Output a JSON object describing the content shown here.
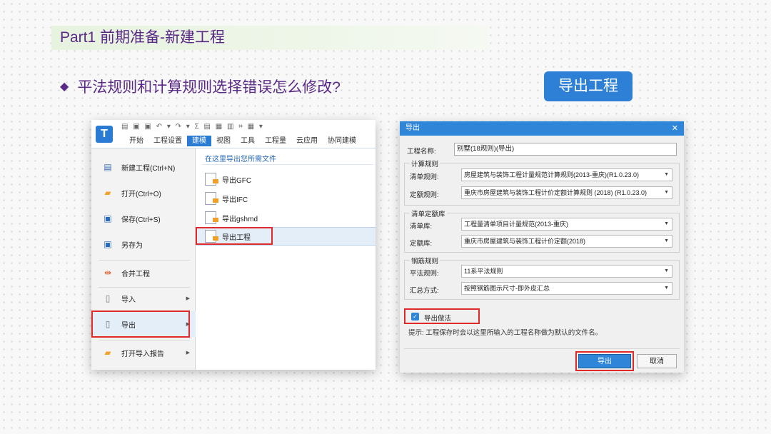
{
  "slide": {
    "title": "Part1 前期准备-新建工程",
    "bullet_symbol": "◆",
    "question": "平法规则和计算规则选择错误怎么修改?",
    "export_button": "导出工程"
  },
  "left_shot": {
    "logo": "T",
    "quick_access": "▤ ▣ ▣ ↶ ▾ ↷ ▾ Σ ▤ ▦ ▥ ⌗ ▦ ▾",
    "tabs": [
      "开始",
      "工程设置",
      "建模",
      "视图",
      "工具",
      "工程量",
      "云应用",
      "协同建模"
    ],
    "active_tab": "建模",
    "file_menu": [
      {
        "label": "新建工程(Ctrl+N)",
        "icon": "new-file-icon"
      },
      {
        "label": "打开(Ctrl+O)",
        "icon": "folder-open-icon"
      },
      {
        "label": "保存(Ctrl+S)",
        "icon": "save-icon"
      },
      {
        "label": "另存为",
        "icon": "save-as-icon"
      },
      {
        "label": "合并工程",
        "icon": "merge-icon"
      },
      {
        "label": "导入",
        "icon": "import-icon"
      },
      {
        "label": "导出",
        "icon": "export-icon"
      },
      {
        "label": "打开导入报告",
        "icon": "report-folder-icon"
      }
    ],
    "submenu_header": "在这里导出您所需文件",
    "submenu": [
      "导出GFC",
      "导出IFC",
      "导出gshmd",
      "导出工程"
    ]
  },
  "dialog": {
    "title": "导出",
    "project_name_label": "工程名称:",
    "project_name_value": "别墅(18规则)(导出)",
    "calc_rules": {
      "legend": "计算规则",
      "list_label": "清单规则:",
      "list_value": "房屋建筑与装饰工程计量规范计算规则(2013-重庆)(R1.0.23.0)",
      "quota_label": "定额规则:",
      "quota_value": "重庆市房屋建筑与装饰工程计价定额计算规则 (2018) (R1.0.23.0)"
    },
    "libraries": {
      "legend": "清单定额库",
      "list_label": "清单库:",
      "list_value": "工程量清单项目计量规范(2013-重庆)",
      "quota_label": "定额库:",
      "quota_value": "重庆市房屋建筑与装饰工程计价定额(2018)"
    },
    "rebar_rules": {
      "legend": "钢筋规则",
      "flat_label": "平法规则:",
      "flat_value": "11系平法规则",
      "summary_label": "汇总方式:",
      "summary_value": "按照钢筋图示尺寸-即外皮汇总"
    },
    "export_practice_label": "导出做法",
    "export_practice_checked": true,
    "hint": "提示: 工程保存时会以这里所输入的工程名称做为默认的文件名。",
    "ok_button": "导出",
    "cancel_button": "取消"
  },
  "colors": {
    "title_purple": "#5a2a86",
    "accent_blue": "#2d80d6",
    "highlight_red": "#e02a2a"
  }
}
